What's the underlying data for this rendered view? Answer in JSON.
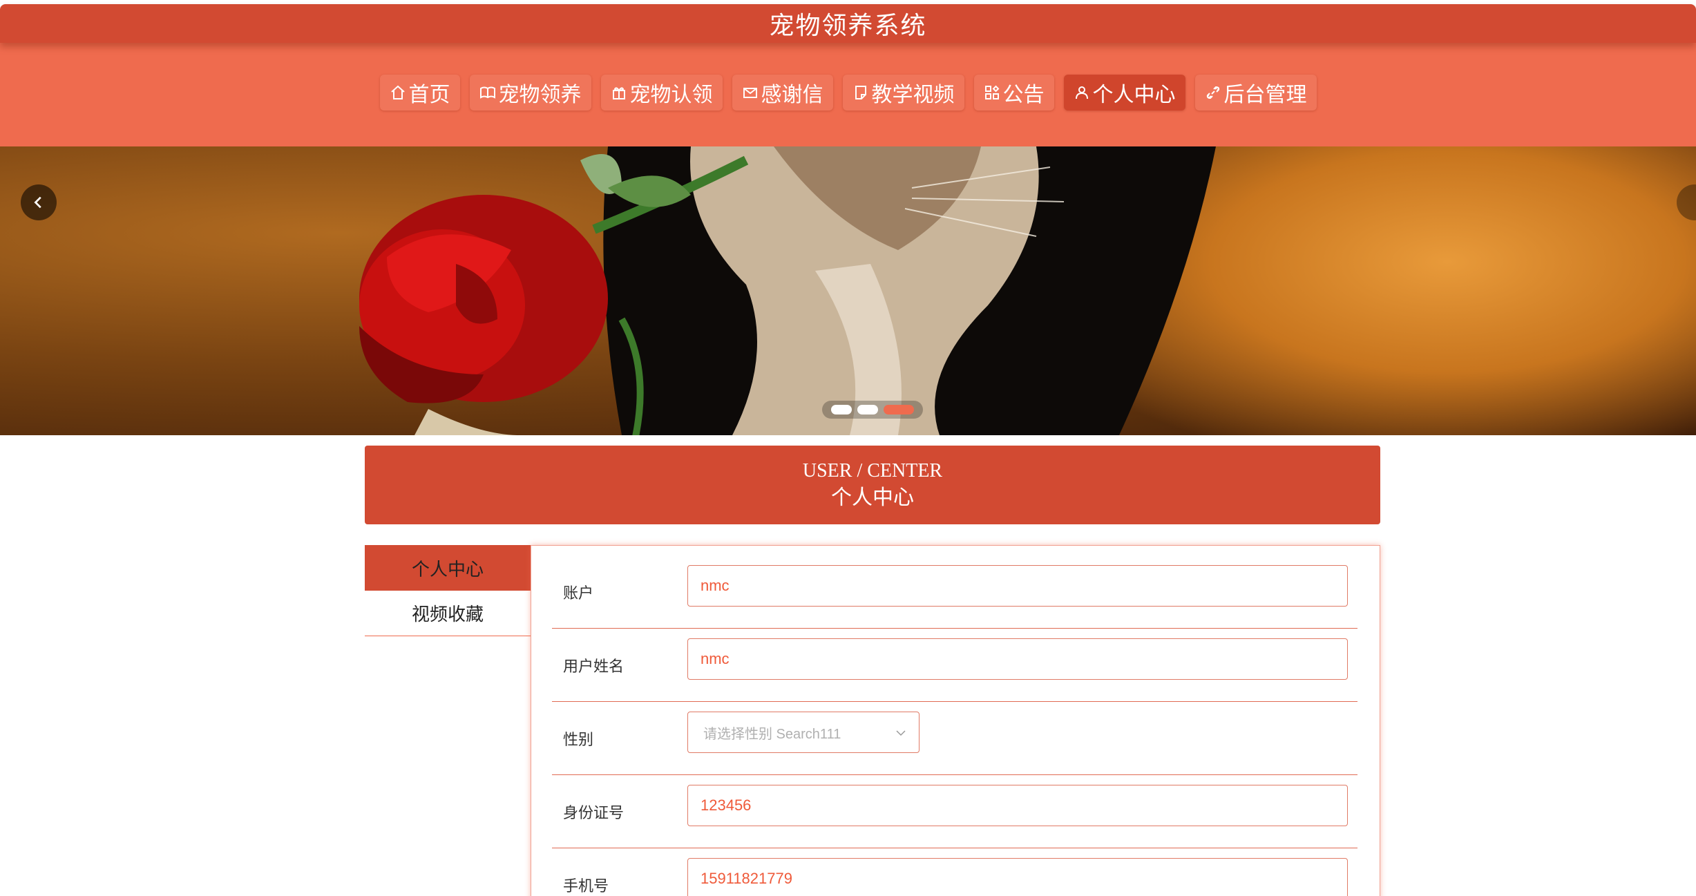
{
  "app": {
    "title": "宠物领养系统"
  },
  "nav": {
    "items": [
      {
        "label": "首页",
        "icon": "home-icon"
      },
      {
        "label": "宠物领养",
        "icon": "book-icon"
      },
      {
        "label": "宠物认领",
        "icon": "gift-icon"
      },
      {
        "label": "感谢信",
        "icon": "mail-icon"
      },
      {
        "label": "教学视频",
        "icon": "document-icon"
      },
      {
        "label": "公告",
        "icon": "grid-icon"
      },
      {
        "label": "个人中心",
        "icon": "user-icon",
        "active": true
      },
      {
        "label": "后台管理",
        "icon": "link-icon"
      }
    ]
  },
  "banner": {
    "slides_total": 3,
    "active_slide": 3
  },
  "section": {
    "title_en": "USER / CENTER",
    "title_zh": "个人中心"
  },
  "sidebar": {
    "items": [
      {
        "label": "个人中心",
        "active": true
      },
      {
        "label": "视频收藏",
        "active": false
      }
    ]
  },
  "form": {
    "account": {
      "label": "账户",
      "value": "nmc"
    },
    "name": {
      "label": "用户姓名",
      "value": "nmc"
    },
    "gender": {
      "label": "性别",
      "placeholder": "请选择性别 Search111"
    },
    "id_card": {
      "label": "身份证号",
      "value": "123456"
    },
    "phone": {
      "label": "手机号",
      "value": "15911821779"
    }
  },
  "colors": {
    "primary": "#d24a32",
    "accent": "#ef6b4e",
    "white": "#ffffff"
  }
}
